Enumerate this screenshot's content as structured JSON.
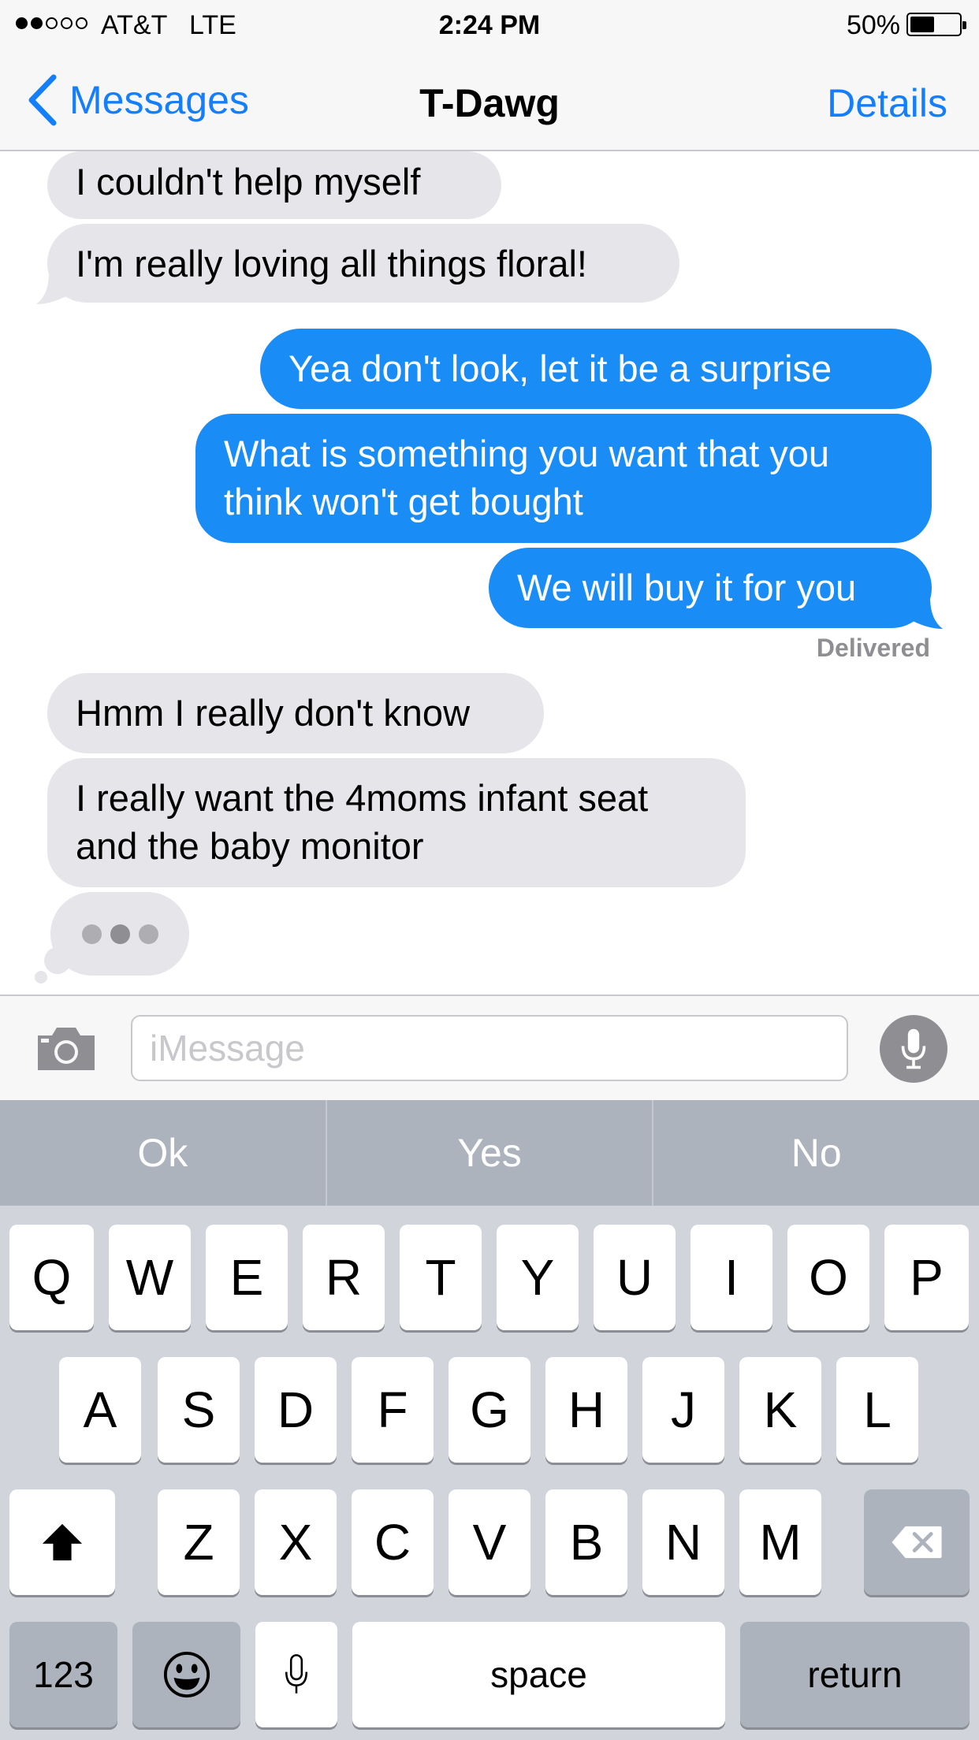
{
  "status_bar": {
    "carrier": "AT&T",
    "network": "LTE",
    "time": "2:24 PM",
    "battery_percent": "50%",
    "battery_level": 0.5,
    "signal_bars_filled": 2,
    "signal_bars_total": 5
  },
  "nav": {
    "back_label": "Messages",
    "title": "T-Dawg",
    "details_label": "Details"
  },
  "messages": [
    {
      "direction": "incoming",
      "text": "I couldn't help myself"
    },
    {
      "direction": "incoming",
      "text": "I'm really loving all things floral!"
    },
    {
      "direction": "outgoing",
      "text": "Yea don't look, let it be a surprise"
    },
    {
      "direction": "outgoing",
      "text": "What is something you want that you\nthink won't get bought"
    },
    {
      "direction": "outgoing",
      "text": "We will buy it for you"
    },
    {
      "direction": "incoming",
      "text": "Hmm I really don't know"
    },
    {
      "direction": "incoming",
      "text": "I really want the 4moms infant seat\nand the baby monitor"
    }
  ],
  "delivered_label": "Delivered",
  "typing_indicator": true,
  "input": {
    "placeholder": "iMessage",
    "value": ""
  },
  "suggestions": [
    "Ok",
    "Yes",
    "No"
  ],
  "keyboard": {
    "row1": [
      "Q",
      "W",
      "E",
      "R",
      "T",
      "Y",
      "U",
      "I",
      "O",
      "P"
    ],
    "row2": [
      "A",
      "S",
      "D",
      "F",
      "G",
      "H",
      "J",
      "K",
      "L"
    ],
    "row3": [
      "Z",
      "X",
      "C",
      "V",
      "B",
      "N",
      "M"
    ],
    "numbers_label": "123",
    "space_label": "space",
    "return_label": "return"
  },
  "colors": {
    "accent": "#147efb",
    "outgoing_bubble": "#1a8cf5",
    "incoming_bubble": "#e5e5ea",
    "keyboard_bg": "#d1d5db",
    "suggestion_bar": "#acb3bc"
  },
  "icons": [
    "chevron-left-icon",
    "camera-icon",
    "microphone-icon",
    "shift-arrow-icon",
    "backspace-icon",
    "emoji-icon",
    "dictation-icon"
  ]
}
